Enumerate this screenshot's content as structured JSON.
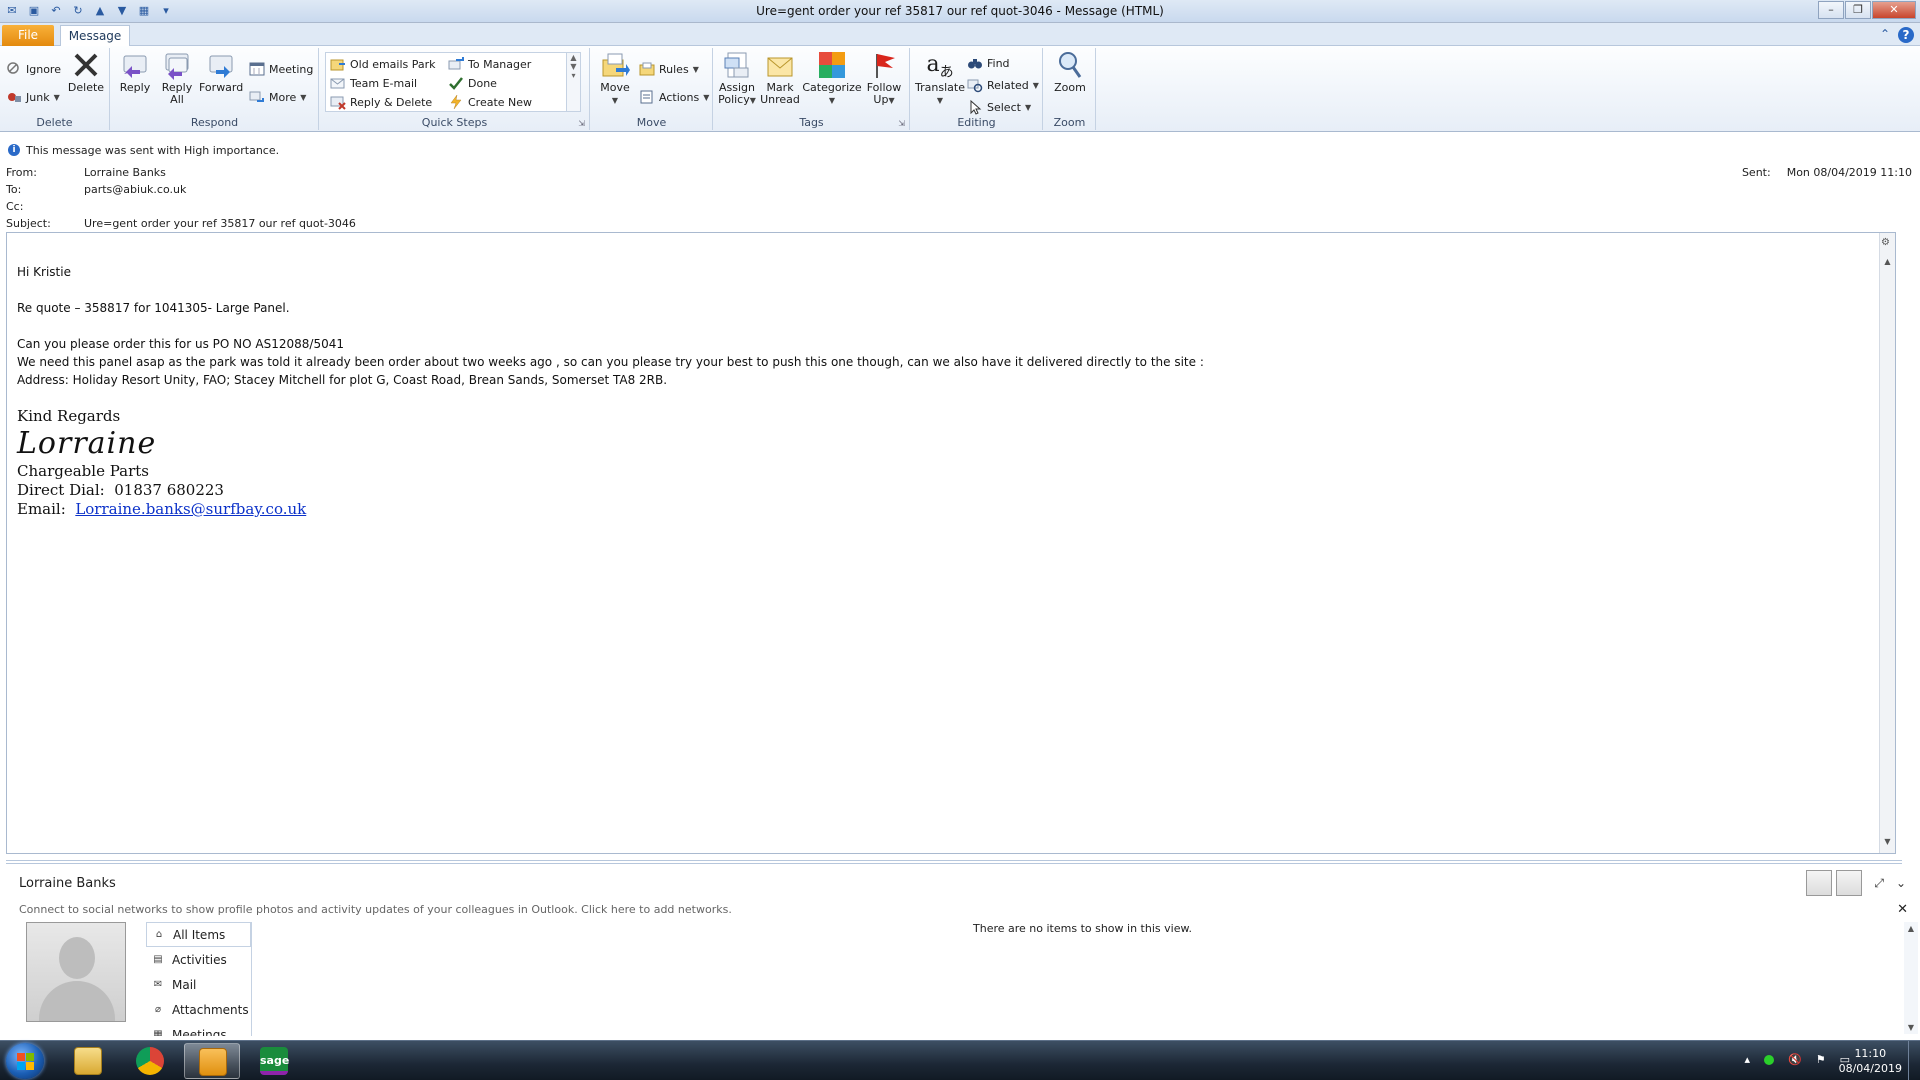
{
  "window": {
    "title": "Ure=gent order your ref 35817  our ref quot-3046  -  Message (HTML)",
    "controls": {
      "minimize": "–",
      "maximize": "❐",
      "close": "✕"
    }
  },
  "tabs": {
    "file": "File",
    "message": "Message"
  },
  "ribbon": {
    "delete_group": {
      "label": "Delete",
      "ignore": "Ignore",
      "junk": "Junk",
      "delete": "Delete"
    },
    "respond_group": {
      "label": "Respond",
      "reply": "Reply",
      "reply_all_1": "Reply",
      "reply_all_2": "All",
      "forward": "Forward",
      "meeting": "Meeting",
      "more": "More"
    },
    "quick_steps_group": {
      "label": "Quick Steps",
      "items": [
        "Old emails Park",
        "Team E-mail",
        "Reply & Delete",
        "To Manager",
        "Done",
        "Create New"
      ]
    },
    "move_group": {
      "label": "Move",
      "move": "Move",
      "rules": "Rules",
      "actions": "Actions"
    },
    "tags_group": {
      "label": "Tags",
      "assign_policy_1": "Assign",
      "assign_policy_2": "Policy",
      "mark_unread_1": "Mark",
      "mark_unread_2": "Unread",
      "categorize": "Categorize",
      "follow_up_1": "Follow",
      "follow_up_2": "Up"
    },
    "editing_group": {
      "label": "Editing",
      "translate": "Translate",
      "find": "Find",
      "related": "Related",
      "select": "Select"
    },
    "zoom_group": {
      "label": "Zoom",
      "zoom": "Zoom"
    }
  },
  "header": {
    "importance": "This message was sent with High importance.",
    "from_label": "From:",
    "from": "Lorraine Banks",
    "to_label": "To:",
    "to": "parts@abiuk.co.uk",
    "cc_label": "Cc:",
    "cc": "",
    "subject_label": "Subject:",
    "subject": "Ure=gent order your ref 35817  our ref quot-3046",
    "sent_label": "Sent:",
    "sent": "Mon 08/04/2019 11:10"
  },
  "body": {
    "greeting": "Hi Kristie",
    "line1": "Re quote – 358817 for 1041305- Large Panel.",
    "line2": "Can you please order this for us PO NO AS12088/5041",
    "line3": "We need this panel asap  as the park was told it already been order about two weeks ago , so can you please try your best to push this one though, can we also have it delivered directly to the site :",
    "line4": "Address: Holiday Resort Unity,  FAO; Stacey Mitchell  for plot  G, Coast Road, Brean Sands, Somerset TA8 2RB.",
    "sig_regards": "Kind Regards",
    "sig_name": "Lorraine",
    "sig_dept": "Chargeable Parts",
    "sig_dial_label": "Direct Dial:",
    "sig_dial": "01837 680223",
    "sig_email_label": "Email:",
    "sig_email": "Lorraine.banks@surfbay.co.uk"
  },
  "people_pane": {
    "name": "Lorraine Banks",
    "social": "Connect to social networks to show profile photos and activity updates of your colleagues in Outlook. Click here to add networks.",
    "filters": [
      "All Items",
      "Activities",
      "Mail",
      "Attachments",
      "Meetings"
    ],
    "empty": "There are no items to show in this view."
  },
  "taskbar": {
    "time": "11:10",
    "date": "08/04/2019",
    "sage_label": "sage"
  },
  "colors": {
    "accent": "#2a6ac8",
    "file_tab": "#e38a0e",
    "link": "#0b31c9"
  }
}
